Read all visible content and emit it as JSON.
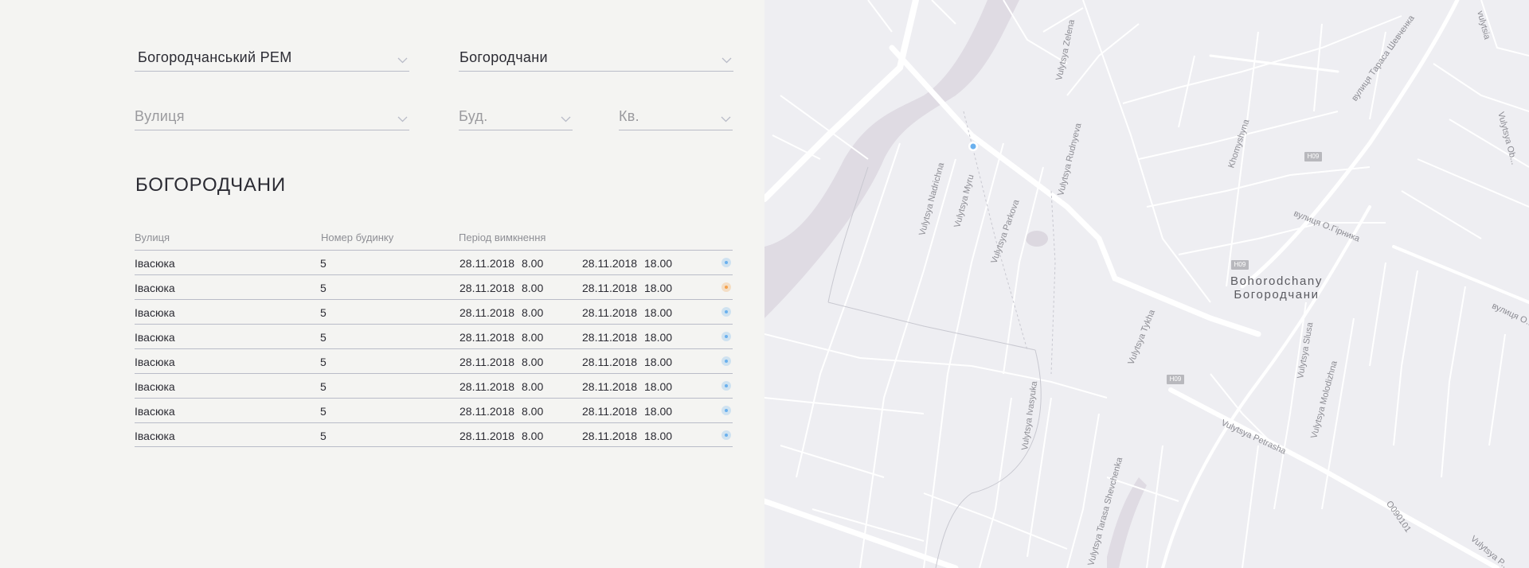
{
  "filters": {
    "district": {
      "value": "Богородчанський РЕМ"
    },
    "settlement": {
      "value": "Богородчани"
    },
    "street": {
      "placeholder": "Вулиця"
    },
    "building": {
      "placeholder": "Буд."
    },
    "apartment": {
      "placeholder": "Кв."
    }
  },
  "city_title": "БОГОРОДЧАНИ",
  "table": {
    "headers": {
      "street": "Вулиця",
      "house": "Номер будинку",
      "period": "Період вимкнення"
    },
    "rows": [
      {
        "street": "Івасюка",
        "house": "5",
        "start_date": "28.11.2018",
        "start_time": "8.00",
        "end_date": "28.11.2018",
        "end_time": "18.00",
        "status": "blue"
      },
      {
        "street": "Івасюка",
        "house": "5",
        "start_date": "28.11.2018",
        "start_time": "8.00",
        "end_date": "28.11.2018",
        "end_time": "18.00",
        "status": "orange"
      },
      {
        "street": "Івасюка",
        "house": "5",
        "start_date": "28.11.2018",
        "start_time": "8.00",
        "end_date": "28.11.2018",
        "end_time": "18.00",
        "status": "blue"
      },
      {
        "street": "Івасюка",
        "house": "5",
        "start_date": "28.11.2018",
        "start_time": "8.00",
        "end_date": "28.11.2018",
        "end_time": "18.00",
        "status": "blue"
      },
      {
        "street": "Івасюка",
        "house": "5",
        "start_date": "28.11.2018",
        "start_time": "8.00",
        "end_date": "28.11.2018",
        "end_time": "18.00",
        "status": "blue"
      },
      {
        "street": "Івасюка",
        "house": "5",
        "start_date": "28.11.2018",
        "start_time": "8.00",
        "end_date": "28.11.2018",
        "end_time": "18.00",
        "status": "blue"
      },
      {
        "street": "Івасюка",
        "house": "5",
        "start_date": "28.11.2018",
        "start_time": "8.00",
        "end_date": "28.11.2018",
        "end_time": "18.00",
        "status": "blue"
      },
      {
        "street": "Івасюка",
        "house": "5",
        "start_date": "28.11.2018",
        "start_time": "8.00",
        "end_date": "28.11.2018",
        "end_time": "18.00",
        "status": "blue"
      }
    ]
  },
  "status_colors": {
    "blue": "#6ab0ee",
    "orange": "#f5a04a"
  },
  "icons": {
    "dropdown": "chevron-down-icon",
    "status": "status-dot-icon",
    "marker": "map-marker-icon"
  },
  "map": {
    "town_latin": "Bohorodchany",
    "town_cyrillic": "Богородчани",
    "road_shields": [
      "H09",
      "H09",
      "H09"
    ],
    "street_labels": [
      "Vulytsya Zelena",
      "Vulytsya Rudnyeva",
      "Vulytsya Nadrichna",
      "Vulytsya Myru",
      "Vulytsya Parkova",
      "Khomyshyna",
      "вулиця О.Гірника",
      "вулиця Тараса Шевченка",
      "Vulytsya Tykha",
      "Vulytsya Slusa",
      "Vulytsya Molodizhna",
      "Vulytsya Ivasyuka",
      "Vulytsya Petrasha",
      "Vulytsya Tarasa Shevchenka",
      "O090101",
      "вулиця О...",
      "Vulytsya Ob...",
      "Vulytsya P...",
      "vulytsia"
    ]
  }
}
